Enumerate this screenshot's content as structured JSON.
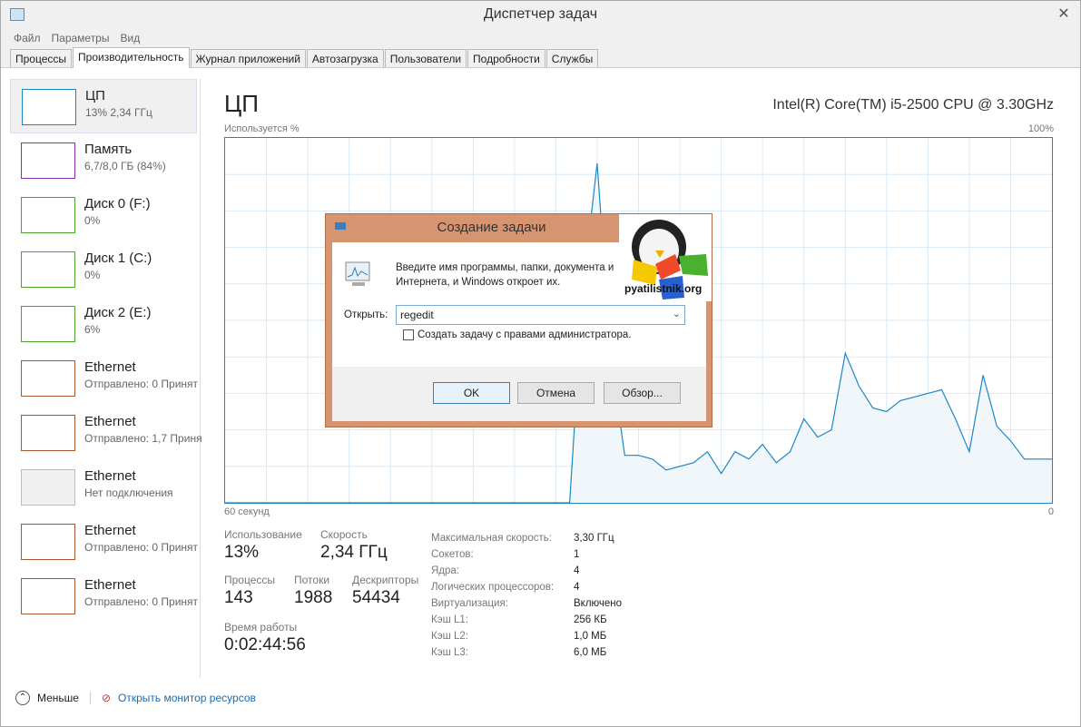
{
  "window": {
    "title": "Диспетчер задач",
    "close": "✕"
  },
  "menu": [
    "Файл",
    "Параметры",
    "Вид"
  ],
  "tabs": [
    "Процессы",
    "Производительность",
    "Журнал приложений",
    "Автозагрузка",
    "Пользователи",
    "Подробности",
    "Службы"
  ],
  "active_tab": 1,
  "sidebar": [
    {
      "name": "ЦП",
      "sub": "13% 2,34 ГГц",
      "color": "#1a86c8"
    },
    {
      "name": "Память",
      "sub": "6,7/8,0 ГБ (84%)",
      "color": "#8b2fb0"
    },
    {
      "name": "Диск 0 (F:)",
      "sub": "0%",
      "color": "#4da628"
    },
    {
      "name": "Диск 1 (C:)",
      "sub": "0%",
      "color": "#4da628"
    },
    {
      "name": "Диск 2 (E:)",
      "sub": "6%",
      "color": "#4da628"
    },
    {
      "name": "Ethernet",
      "sub": "Отправлено: 0 Принят",
      "color": "#a7582c"
    },
    {
      "name": "Ethernet",
      "sub": "Отправлено: 1,7 Приня",
      "color": "#a7582c"
    },
    {
      "name": "Ethernet",
      "sub": "Нет подключения",
      "color": "#bbbbbb"
    },
    {
      "name": "Ethernet",
      "sub": "Отправлено: 0 Принят",
      "color": "#a7582c"
    },
    {
      "name": "Ethernet",
      "sub": "Отправлено: 0 Принят",
      "color": "#a7582c"
    }
  ],
  "main": {
    "title": "ЦП",
    "cpu": "Intel(R) Core(TM) i5-2500 CPU @ 3.30GHz",
    "ylabel": "Используется %",
    "ymax": "100%",
    "xleft": "60 секунд",
    "xright": "0"
  },
  "chart_data": {
    "type": "area",
    "title": "ЦП",
    "ylabel": "Используется %",
    "xlabel": "60 секунд",
    "ylim": [
      0,
      100
    ],
    "xlim": [
      -60,
      0
    ],
    "values": [
      0,
      0,
      0,
      0,
      0,
      0,
      0,
      0,
      0,
      0,
      0,
      0,
      0,
      0,
      0,
      0,
      0,
      0,
      0,
      0,
      0,
      0,
      0,
      0,
      0,
      0,
      60,
      93,
      40,
      13,
      13,
      12,
      9,
      10,
      11,
      14,
      8,
      14,
      12,
      16,
      11,
      14,
      23,
      18,
      20,
      41,
      32,
      26,
      25,
      28,
      29,
      30,
      31,
      23,
      14,
      35,
      21,
      17,
      12,
      12,
      12
    ],
    "color": "#1a86c8"
  },
  "stats": {
    "usage_label": "Использование",
    "usage": "13%",
    "speed_label": "Скорость",
    "speed": "2,34 ГГц",
    "proc_label": "Процессы",
    "proc": "143",
    "threads_label": "Потоки",
    "threads": "1988",
    "handles_label": "Дескрипторы",
    "handles": "54434",
    "uptime_label": "Время работы",
    "uptime": "0:02:44:56"
  },
  "specs": [
    [
      "Максимальная скорость:",
      "3,30 ГГц"
    ],
    [
      "Сокетов:",
      "1"
    ],
    [
      "Ядра:",
      "4"
    ],
    [
      "Логических процессоров:",
      "4"
    ],
    [
      "Виртуализация:",
      "Включено"
    ],
    [
      "Кэш L1:",
      "256 КБ"
    ],
    [
      "Кэш L2:",
      "1,0 МБ"
    ],
    [
      "Кэш L3:",
      "6,0 МБ"
    ]
  ],
  "bottom": {
    "less": "Меньше",
    "monitor": "Открыть монитор ресурсов"
  },
  "dialog": {
    "title": "Создание задачи",
    "text1": "Введите имя программы, папки, документа и",
    "text2": "Интернета, и Windows откроет их.",
    "open_label": "Открыть:",
    "value": "regedit",
    "admin": "Создать задачу с правами администратора.",
    "ok": "OK",
    "cancel": "Отмена",
    "browse": "Обзор...",
    "watermark": "pyatilistnik.org"
  }
}
